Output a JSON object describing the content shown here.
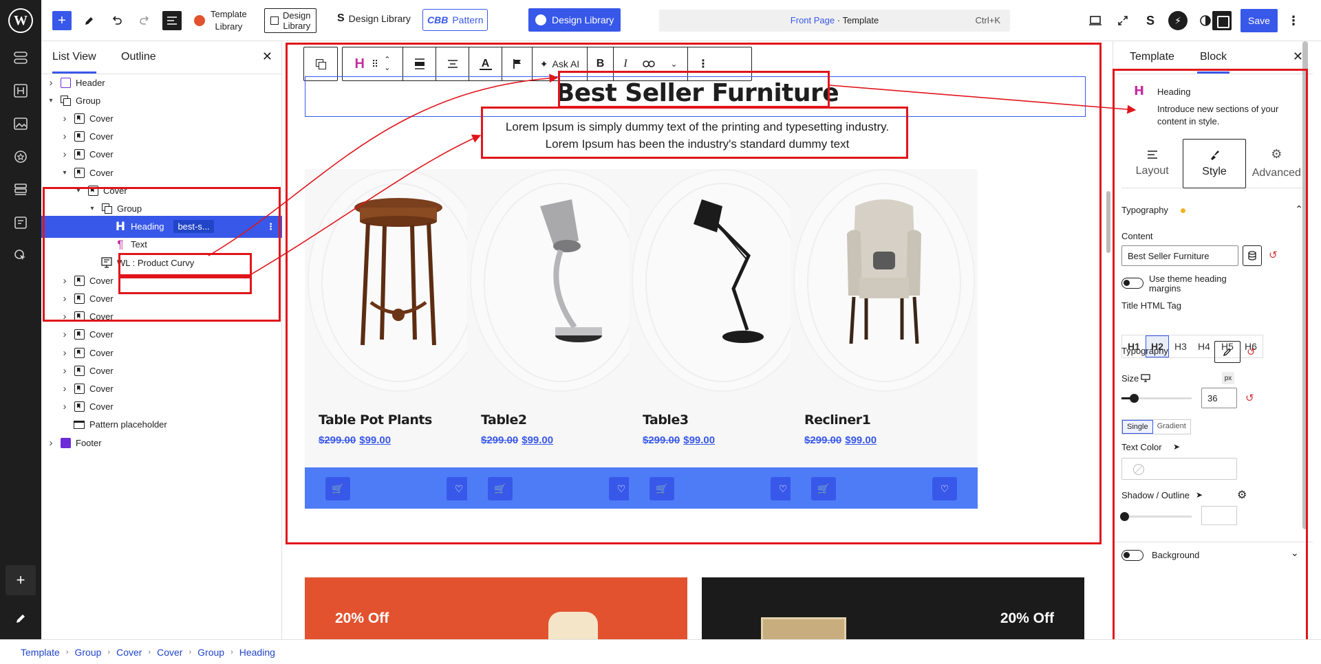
{
  "topbar": {
    "template_library_label": "Template\nLibrary",
    "design_library_box_label": "Design\nLibrary",
    "design_library_label": "Design Library",
    "cbb_label": "CBB",
    "pattern_label": "Pattern",
    "design_library_button": "Design Library",
    "command_page": "Front Page",
    "command_sep": " · ",
    "command_type": "Template",
    "command_shortcut": "Ctrl+K",
    "save_label": "Save"
  },
  "list_view": {
    "tabs": [
      "List View",
      "Outline"
    ],
    "rows": [
      {
        "label": "Header",
        "icon": "template-part-icon",
        "level": 0,
        "expand": "collapsed"
      },
      {
        "label": "Group",
        "icon": "group-icon",
        "level": 0,
        "expand": "expanded"
      },
      {
        "label": "Cover",
        "icon": "cover-icon",
        "level": 1,
        "expand": "collapsed"
      },
      {
        "label": "Cover",
        "icon": "cover-icon",
        "level": 1,
        "expand": "collapsed"
      },
      {
        "label": "Cover",
        "icon": "cover-icon",
        "level": 1,
        "expand": "collapsed"
      },
      {
        "label": "Cover",
        "icon": "cover-icon",
        "level": 1,
        "expand": "expanded"
      },
      {
        "label": "Cover",
        "icon": "cover-icon",
        "level": 2,
        "expand": "expanded"
      },
      {
        "label": "Group",
        "icon": "group-icon",
        "level": 3,
        "expand": "expanded"
      },
      {
        "label": "Heading",
        "icon": "heading-icon",
        "level": 4,
        "expand": "none",
        "selected": true,
        "anchor": "best-s..."
      },
      {
        "label": "Text",
        "icon": "paragraph-icon",
        "level": 4,
        "expand": "none"
      },
      {
        "label": "WL : Product Curvy",
        "icon": "product-block-icon",
        "level": 3,
        "expand": "none"
      },
      {
        "label": "Cover",
        "icon": "cover-icon",
        "level": 1,
        "expand": "collapsed"
      },
      {
        "label": "Cover",
        "icon": "cover-icon",
        "level": 1,
        "expand": "collapsed"
      },
      {
        "label": "Cover",
        "icon": "cover-icon",
        "level": 1,
        "expand": "collapsed"
      },
      {
        "label": "Cover",
        "icon": "cover-icon",
        "level": 1,
        "expand": "collapsed"
      },
      {
        "label": "Cover",
        "icon": "cover-icon",
        "level": 1,
        "expand": "collapsed"
      },
      {
        "label": "Cover",
        "icon": "cover-icon",
        "level": 1,
        "expand": "collapsed"
      },
      {
        "label": "Cover",
        "icon": "cover-icon",
        "level": 1,
        "expand": "collapsed"
      },
      {
        "label": "Cover",
        "icon": "cover-icon",
        "level": 1,
        "expand": "collapsed"
      },
      {
        "label": "Pattern placeholder",
        "icon": "pattern-placeholder-icon",
        "level": 1,
        "expand": "none"
      },
      {
        "label": "Footer",
        "icon": "template-part-icon",
        "level": 0,
        "expand": "collapsed"
      }
    ]
  },
  "canvas": {
    "toolbar_ask_ai": "Ask AI",
    "heading": "Best Seller Furniture",
    "subtext_line1": "Lorem Ipsum is simply dummy text of the printing and typesetting industry.",
    "subtext_line2": "Lorem Ipsum has been the industry's standard dummy text",
    "products": [
      {
        "title": "Table Pot Plants",
        "old_price": "$299.00",
        "new_price": "$99.00",
        "image": "round-side-table"
      },
      {
        "title": "Table2",
        "old_price": "$299.00",
        "new_price": "$99.00",
        "image": "silver-desk-lamp"
      },
      {
        "title": "Table3",
        "old_price": "$299.00",
        "new_price": "$99.00",
        "image": "black-desk-lamp"
      },
      {
        "title": "Recliner1",
        "old_price": "$299.00",
        "new_price": "$99.00",
        "image": "wingback-chair"
      }
    ],
    "promo_left": "20% Off",
    "promo_right": "20% Off"
  },
  "sidebar": {
    "tabs": [
      "Template",
      "Block"
    ],
    "block_name": "Heading",
    "block_description": "Introduce new sections of your content in style.",
    "segments": [
      "Layout",
      "Style",
      "Advanced"
    ],
    "typography_section": "Typography",
    "content_label": "Content",
    "content_value": "Best Seller Furniture",
    "theme_margins_label": "Use theme heading margins",
    "title_tag_label": "Title HTML Tag",
    "tags": [
      "H1",
      "H2",
      "H3",
      "H4",
      "H5",
      "H6"
    ],
    "selected_tag": "H2",
    "typography_label": "Typography",
    "size_label": "Size",
    "size_unit": "px",
    "size_value": "36",
    "size_level": 0.18,
    "color_modes": [
      "Single",
      "Gradient"
    ],
    "text_color_label": "Text Color",
    "shadow_label": "Shadow / Outline",
    "background_label": "Background"
  },
  "breadcrumb": [
    "Template",
    "Group",
    "Cover",
    "Cover",
    "Group",
    "Heading"
  ],
  "colors": {
    "accent": "#3858e9",
    "annotation_red": "#e0151b",
    "card_bar": "#4e7cf6",
    "promo_left_bg": "#e2522f",
    "promo_right_bg": "#1b1b1b"
  }
}
